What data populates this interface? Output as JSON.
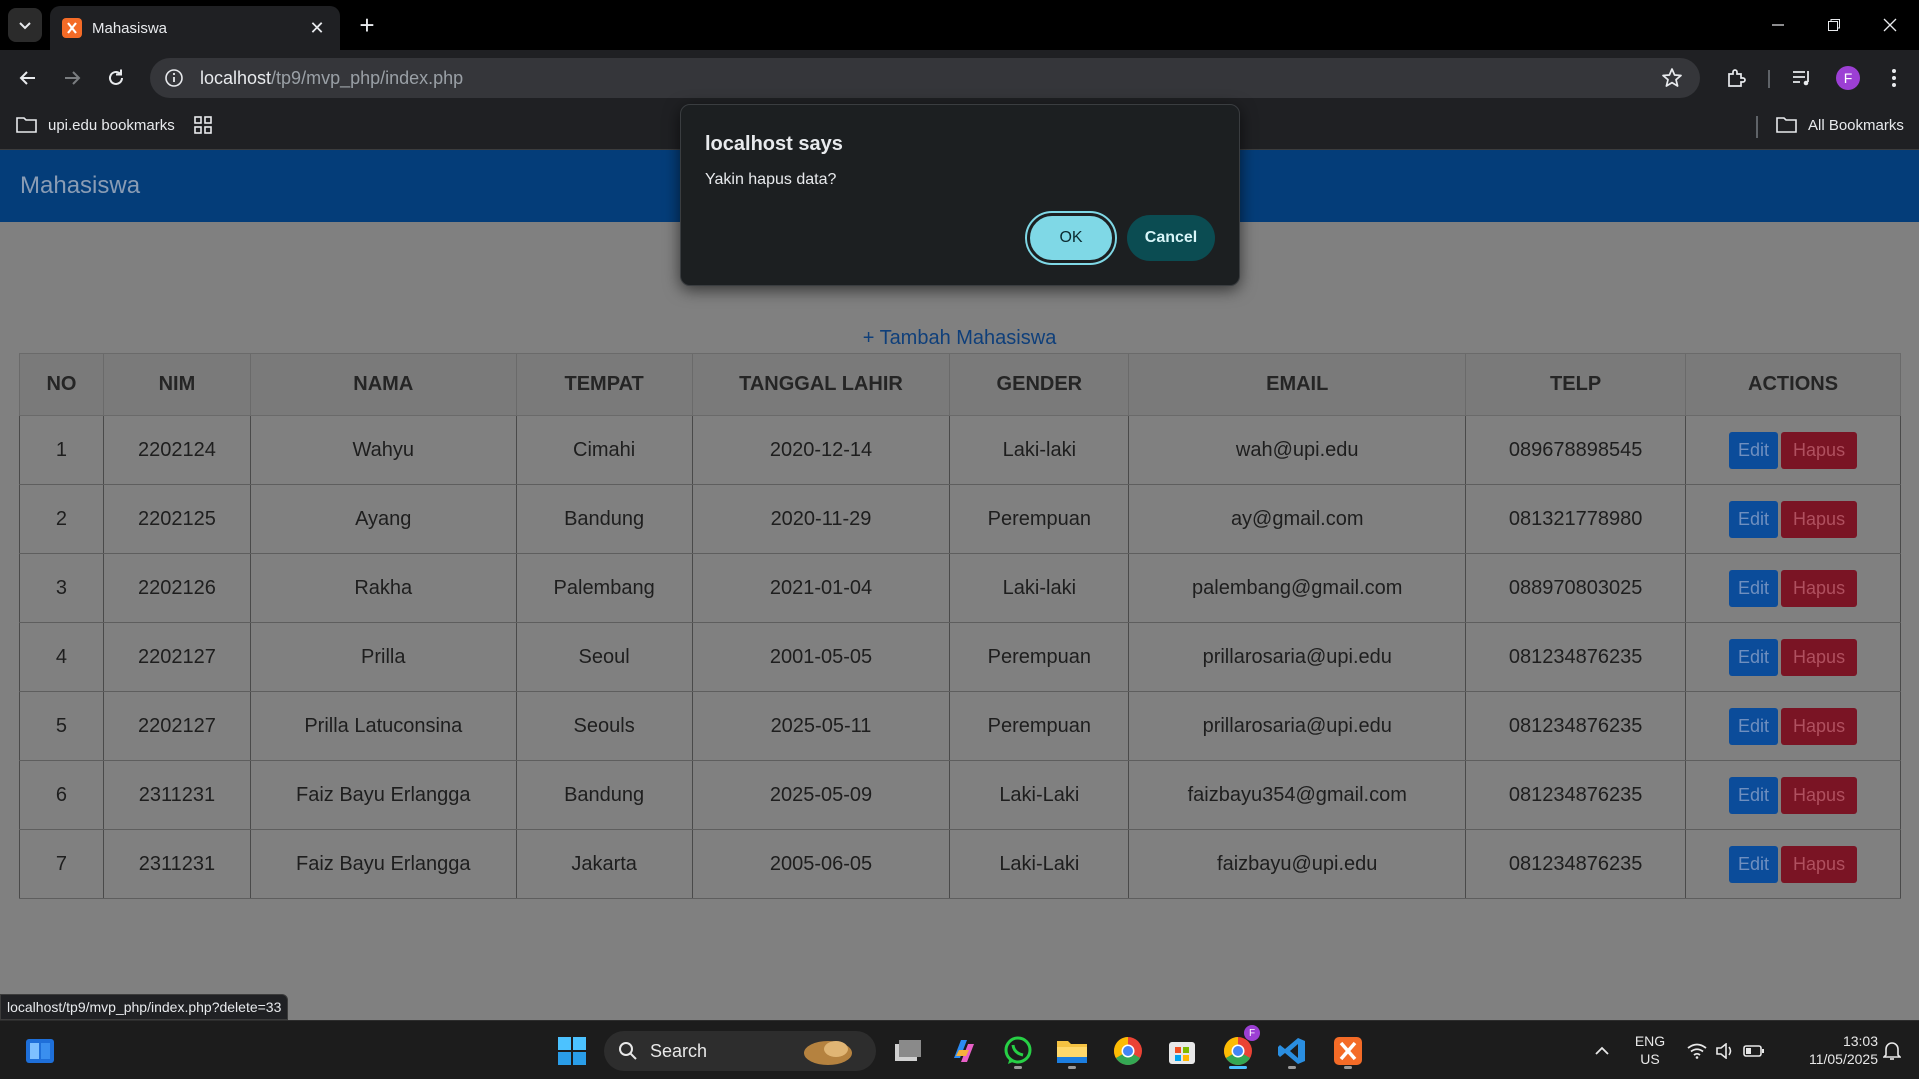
{
  "browser": {
    "tab_title": "Mahasiswa",
    "url_host": "localhost",
    "url_path": "/tp9/mvp_php/index.php",
    "profile_initial": "F",
    "bookmarks": {
      "folder_label": "upi.edu bookmarks",
      "all_label": "All Bookmarks"
    },
    "status_url": "localhost/tp9/mvp_php/index.php?delete=33"
  },
  "page": {
    "brand": "Mahasiswa",
    "add_link": "+ Tambah Mahasiswa",
    "table": {
      "headers": [
        "NO",
        "NIM",
        "NAMA",
        "TEMPAT",
        "TANGGAL LAHIR",
        "GENDER",
        "EMAIL",
        "TELP",
        "ACTIONS"
      ],
      "edit_label": "Edit",
      "delete_label": "Hapus",
      "rows": [
        [
          "1",
          "2202124",
          "Wahyu",
          "Cimahi",
          "2020-12-14",
          "Laki-laki",
          "wah@upi.edu",
          "089678898545"
        ],
        [
          "2",
          "2202125",
          "Ayang",
          "Bandung",
          "2020-11-29",
          "Perempuan",
          "ay@gmail.com",
          "081321778980"
        ],
        [
          "3",
          "2202126",
          "Rakha",
          "Palembang",
          "2021-01-04",
          "Laki-laki",
          "palembang@gmail.com",
          "088970803025"
        ],
        [
          "4",
          "2202127",
          "Prilla",
          "Seoul",
          "2001-05-05",
          "Perempuan",
          "prillarosaria@upi.edu",
          "081234876235"
        ],
        [
          "5",
          "2202127",
          "Prilla Latuconsina",
          "Seouls",
          "2025-05-11",
          "Perempuan",
          "prillarosaria@upi.edu",
          "081234876235"
        ],
        [
          "6",
          "2311231",
          "Faiz Bayu Erlangga",
          "Bandung",
          "2025-05-09",
          "Laki-Laki",
          "faizbayu354@gmail.com",
          "081234876235"
        ],
        [
          "7",
          "2311231",
          "Faiz Bayu Erlangga",
          "Jakarta",
          "2005-06-05",
          "Laki-Laki",
          "faizbayu@upi.edu",
          "081234876235"
        ]
      ]
    }
  },
  "dialog": {
    "title": "localhost says",
    "message": "Yakin hapus data?",
    "ok_label": "OK",
    "cancel_label": "Cancel"
  },
  "taskbar": {
    "search_label": "Search",
    "lang_line1": "ENG",
    "lang_line2": "US",
    "time": "13:03",
    "date": "11/05/2025",
    "chrome_badge": "F"
  },
  "colors": {
    "navbar": "#043d79",
    "edit_button": "#0b4c9a",
    "delete_button": "#7a1424",
    "dialog_ok": "#7fd8e6",
    "dialog_cancel": "#0b4c52"
  }
}
